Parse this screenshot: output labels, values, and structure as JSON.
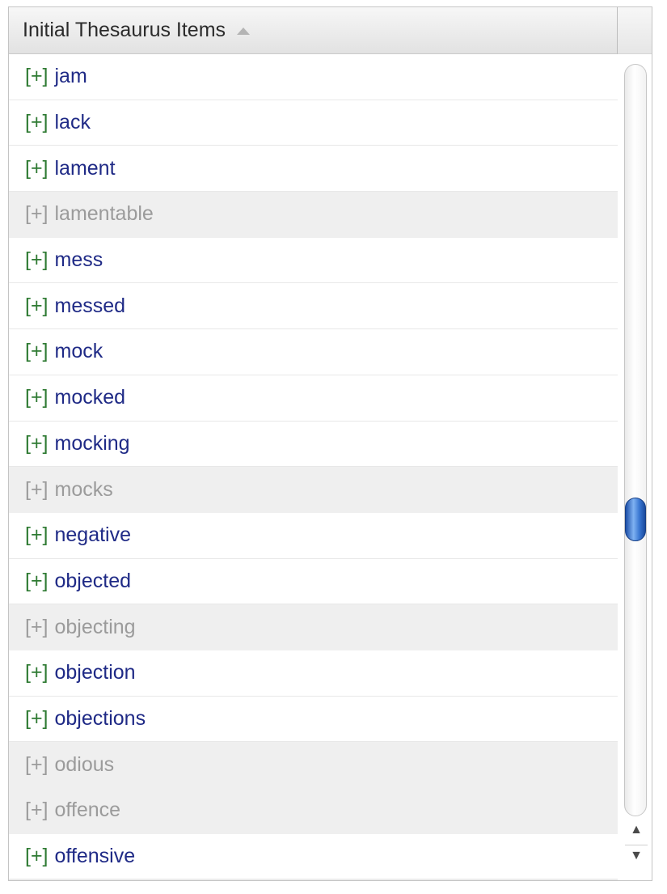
{
  "header": {
    "title": "Initial Thesaurus Items"
  },
  "colors": {
    "plus_active": "#2e7a32",
    "word_active": "#1f2a86",
    "disabled_text": "#9b9b9b",
    "disabled_row_bg": "#efefef",
    "scroll_thumb": "#3a77d2"
  },
  "icons": {
    "sort": "sort-ascending-icon",
    "scroll_up": "scroll-up-arrow-icon",
    "scroll_down": "scroll-down-arrow-icon"
  },
  "list": {
    "items": [
      {
        "plus": "[+]",
        "word": "jam",
        "disabled": false
      },
      {
        "plus": "[+]",
        "word": "lack",
        "disabled": false
      },
      {
        "plus": "[+]",
        "word": "lament",
        "disabled": false
      },
      {
        "plus": "[+]",
        "word": "lamentable",
        "disabled": true
      },
      {
        "plus": "[+]",
        "word": "mess",
        "disabled": false
      },
      {
        "plus": "[+]",
        "word": "messed",
        "disabled": false
      },
      {
        "plus": "[+]",
        "word": "mock",
        "disabled": false
      },
      {
        "plus": "[+]",
        "word": "mocked",
        "disabled": false
      },
      {
        "plus": "[+]",
        "word": "mocking",
        "disabled": false
      },
      {
        "plus": "[+]",
        "word": "mocks",
        "disabled": true
      },
      {
        "plus": "[+]",
        "word": "negative",
        "disabled": false
      },
      {
        "plus": "[+]",
        "word": "objected",
        "disabled": false
      },
      {
        "plus": "[+]",
        "word": "objecting",
        "disabled": true
      },
      {
        "plus": "[+]",
        "word": "objection",
        "disabled": false
      },
      {
        "plus": "[+]",
        "word": "objections",
        "disabled": false
      },
      {
        "plus": "[+]",
        "word": "odious",
        "disabled": true
      },
      {
        "plus": "[+]",
        "word": "offence",
        "disabled": true
      },
      {
        "plus": "[+]",
        "word": "offensive",
        "disabled": false
      }
    ]
  }
}
